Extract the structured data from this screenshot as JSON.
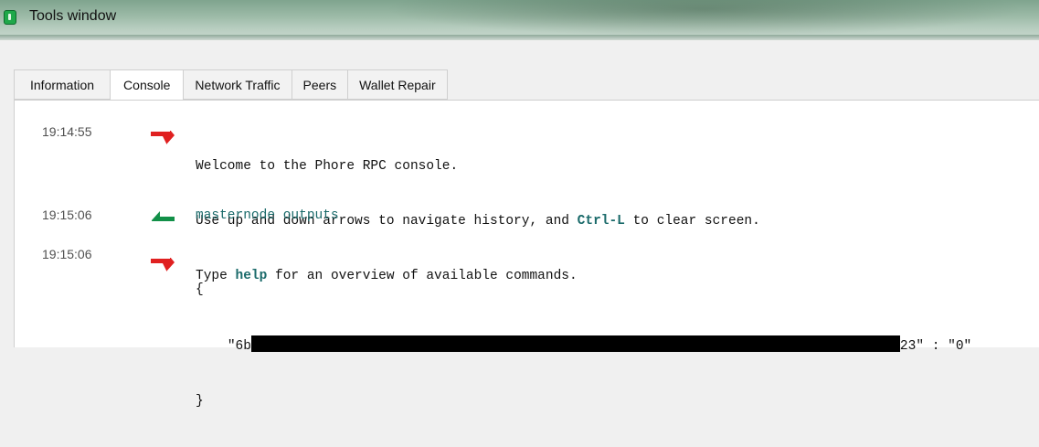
{
  "window": {
    "title": "Tools window"
  },
  "tabs": [
    {
      "label": "Information",
      "active": false
    },
    {
      "label": "Console",
      "active": true
    },
    {
      "label": "Network Traffic",
      "active": false
    },
    {
      "label": "Peers",
      "active": false
    },
    {
      "label": "Wallet Repair",
      "active": false
    }
  ],
  "console": {
    "entries": [
      {
        "time": "19:14:55",
        "direction": "reply",
        "icon": "red-reply-arrow-icon",
        "lines": {
          "l1": "Welcome to the Phore RPC console.",
          "l2_a": "Use up and down arrows to navigate history, and ",
          "l2_key": "Ctrl-L",
          "l2_b": " to clear screen.",
          "l3_a": "Type ",
          "l3_key": "help",
          "l3_b": " for an overview of available commands."
        }
      },
      {
        "time": "19:15:06",
        "direction": "request",
        "icon": "green-request-arrow-icon",
        "command": "masternode outputs"
      },
      {
        "time": "19:15:06",
        "direction": "reply",
        "icon": "red-reply-arrow-icon",
        "json_open": "{",
        "json_key_prefix": "\"6b",
        "json_key_suffix": "23\" : \"0\"",
        "json_close": "}"
      }
    ]
  },
  "colors": {
    "reply_arrow": "#e02020",
    "request_arrow": "#129048",
    "command_text": "#1a6a6a"
  }
}
